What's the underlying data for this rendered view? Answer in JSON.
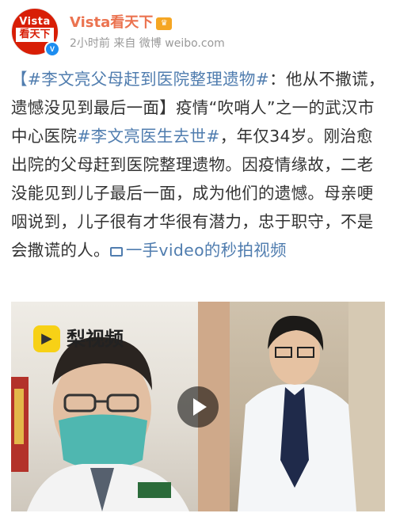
{
  "post": {
    "author": {
      "name": "Vista看天下",
      "avatar_text_top": "Vista",
      "avatar_text_mid": "看天下",
      "verified_icon": "verified-v-icon",
      "member_icon": "crown-icon"
    },
    "meta": "2小时前 来自 微博 weibo.com",
    "content": {
      "tag1": "【#李文亮父母赶到医院整理遗物#",
      "text1": "：他从不撒谎，遗憾没见到最后一面】疫情“吹哨人”之一的武汉市中心医院",
      "tag2": "#李文亮医生去世#",
      "text2": "，年仅34岁。刚治愈出院的父母赶到医院整理遗物。因疫情缘故，二老没能见到儿子最后一面，成为他们的遗憾。母亲哽咽说到，儿子很有才华很有潜力，忠于职守，不是会撒谎的人。",
      "video_link": "一手video的秒拍视频"
    },
    "video": {
      "brand_label": "梨视频",
      "play_icon": "play-icon"
    }
  },
  "colors": {
    "link": "#507daf",
    "author_name": "#eb7350",
    "avatar_red": "#d81e06",
    "meta_gray": "#999999"
  }
}
